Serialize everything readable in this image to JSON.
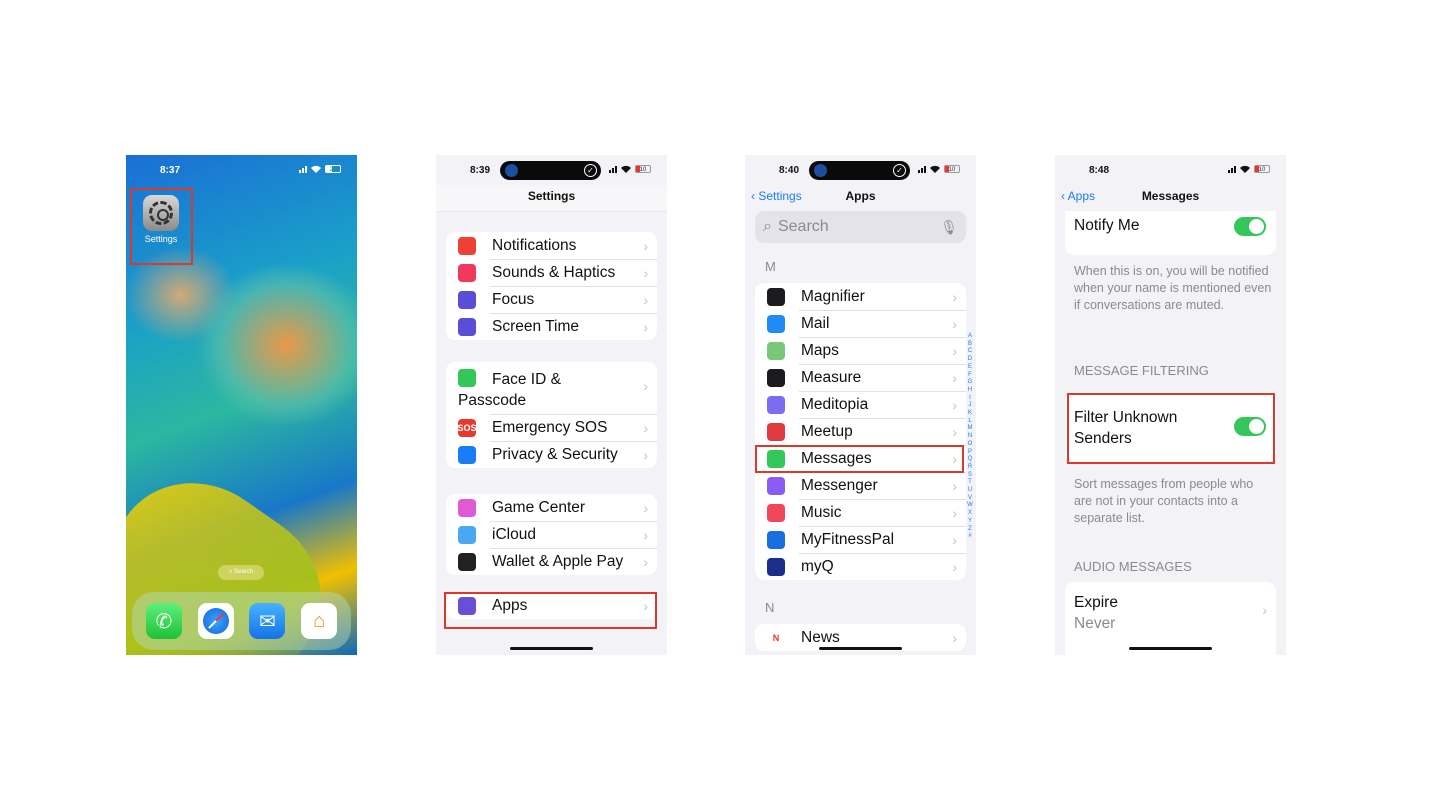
{
  "screens": [
    {
      "name": "home-screen",
      "time": "8:37",
      "battery": "22",
      "app_label": "Settings",
      "search_pill": "Search",
      "dock": [
        "phone-icon",
        "safari-icon",
        "mail-icon",
        "home-icon"
      ]
    },
    {
      "name": "settings",
      "time": "8:39",
      "battery": "10",
      "title": "Settings",
      "groups": [
        [
          "Notifications",
          "Sounds & Haptics",
          "Focus",
          "Screen Time"
        ],
        [
          "Face ID & Passcode",
          "Emergency SOS",
          "Privacy & Security"
        ],
        [
          "Game Center",
          "iCloud",
          "Wallet & Apple Pay"
        ],
        [
          "Apps"
        ]
      ],
      "icon_colors": {
        "Notifications": "#ef4035",
        "Sounds & Haptics": "#ef3a5d",
        "Focus": "#5b4ed6",
        "Screen Time": "#5b4ed6",
        "Face ID & Passcode": "#33c659",
        "Emergency SOS": "#e7392e",
        "Privacy & Security": "#1a7cf5",
        "Game Center": "#e05ad6",
        "iCloud": "#4aa8f0",
        "Wallet & Apple Pay": "#222222",
        "Apps": "#6a4fd6"
      },
      "icon_glyphs": {
        "Emergency SOS": "SOS"
      },
      "highlight": "Apps"
    },
    {
      "name": "apps",
      "time": "8:40",
      "battery": "10",
      "back": "Settings",
      "title": "Apps",
      "search_placeholder": "Search",
      "sections": [
        {
          "letter": "M",
          "items": [
            "Magnifier",
            "Mail",
            "Maps",
            "Measure",
            "Meditopia",
            "Meetup",
            "Messages",
            "Messenger",
            "Music",
            "MyFitnessPal",
            "myQ"
          ]
        },
        {
          "letter": "N",
          "items": [
            "News"
          ]
        }
      ],
      "icon_colors": {
        "Magnifier": "#1c1c1e",
        "Mail": "#1f8cf5",
        "Maps": "#7ac77a",
        "Measure": "#1c1c1e",
        "Meditopia": "#7b6cf0",
        "Meetup": "#e0393e",
        "Messages": "#34c759",
        "Messenger": "#8a5cf5",
        "Music": "#f2475b",
        "MyFitnessPal": "#1a6fe0",
        "myQ": "#1b2f8a",
        "News": "#ffffff"
      },
      "index_letters": [
        "A",
        "B",
        "C",
        "D",
        "E",
        "F",
        "G",
        "H",
        "I",
        "J",
        "K",
        "L",
        "M",
        "N",
        "O",
        "P",
        "Q",
        "R",
        "S",
        "T",
        "U",
        "V",
        "W",
        "X",
        "Y",
        "Z",
        "#"
      ],
      "highlight": "Messages"
    },
    {
      "name": "messages-settings",
      "time": "8:48",
      "battery": "10",
      "back": "Apps",
      "title": "Messages",
      "notify_me": {
        "label": "Notify Me",
        "on": true
      },
      "notify_footer": "When this is on, you will be notified when your name is mentioned even if conversations are muted.",
      "filter_header": "MESSAGE FILTERING",
      "filter": {
        "label": "Filter Unknown Senders",
        "on": true
      },
      "filter_footer": "Sort messages from people who are not in your contacts into a separate list.",
      "audio_header": "AUDIO MESSAGES",
      "expire": {
        "label": "Expire",
        "value": "Never"
      }
    }
  ],
  "colors": {
    "highlight": "#d93a2b",
    "accent": "#1a7cf5",
    "toggle_on": "#34c759"
  }
}
